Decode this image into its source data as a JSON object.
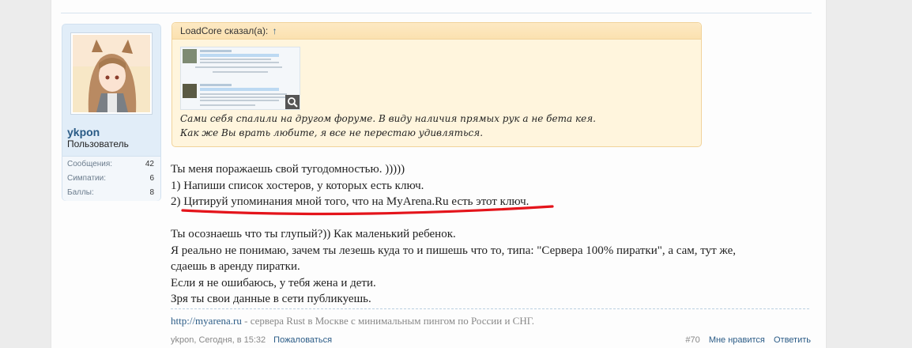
{
  "user": {
    "name": "ykpon",
    "title": "Пользователь",
    "stats": [
      {
        "label": "Сообщения:",
        "value": "42"
      },
      {
        "label": "Симпатии:",
        "value": "6"
      },
      {
        "label": "Баллы:",
        "value": "8"
      }
    ]
  },
  "quote": {
    "author_line": "LoadCore сказал(а):",
    "arrow": "↑",
    "lines": [
      "Сами себя спалили на другом форуме. В виду наличия прямых рук а не бета кея.",
      "Как же Вы врать любите, я все не перестаю удивляться."
    ]
  },
  "message": {
    "lines": [
      "Ты меня поражаешь свой тугодомностью. )))))",
      "1) Напиши список хостеров, у которых есть ключ.",
      "2) Цитируй упоминания мной того, что на MyArena.Ru есть этот ключ."
    ],
    "lines2": [
      "Ты осознаешь что ты глупый?)) Как маленький ребенок.",
      "Я реально не понимаю, зачем ты лезешь куда то и пишешь что то, типа: \"Сервера 100% пиратки\", а сам, тут же,",
      "сдаешь в аренду пиратки.",
      "Если я не ошибаюсь, у тебя жена и дети.",
      "Зря ты свои данные в сети публикуешь."
    ]
  },
  "signature": {
    "link": "http://myarena.ru",
    "text": " - сервера Rust в Москве с минимальным пингом по России и СНГ."
  },
  "footer": {
    "author": "ykpon",
    "date": ", Сегодня, в 15:32",
    "report": "Пожаловаться",
    "post_number": "#70",
    "like": "Мне нравится",
    "reply": "Ответить"
  }
}
